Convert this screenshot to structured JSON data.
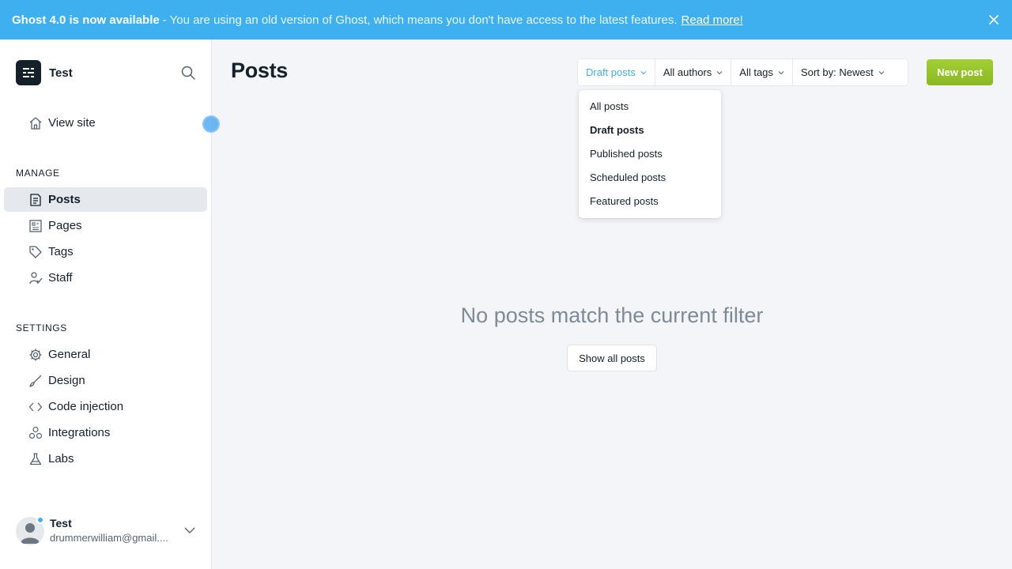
{
  "banner": {
    "strong": "Ghost 4.0 is now available",
    "message": "- You are using an old version of Ghost, which means you don't have access to the latest features.",
    "link": "Read more!",
    "close_icon": "close-icon"
  },
  "sidebar": {
    "site_name": "Test",
    "view_site": "View site",
    "manage_label": "MANAGE",
    "manage_items": [
      {
        "label": "Posts",
        "icon": "posts-icon",
        "active": true
      },
      {
        "label": "Pages",
        "icon": "pages-icon",
        "active": false
      },
      {
        "label": "Tags",
        "icon": "tag-icon",
        "active": false
      },
      {
        "label": "Staff",
        "icon": "staff-icon",
        "active": false
      }
    ],
    "settings_label": "SETTINGS",
    "settings_items": [
      {
        "label": "General",
        "icon": "gear-icon"
      },
      {
        "label": "Design",
        "icon": "brush-icon"
      },
      {
        "label": "Code injection",
        "icon": "code-icon"
      },
      {
        "label": "Integrations",
        "icon": "integrations-icon"
      },
      {
        "label": "Labs",
        "icon": "flask-icon"
      }
    ],
    "user": {
      "name": "Test",
      "email": "drummerwilliam@gmail...."
    }
  },
  "main": {
    "title": "Posts",
    "filters": {
      "type": "Draft posts",
      "authors": "All authors",
      "tags": "All tags",
      "sort": "Sort by: Newest"
    },
    "new_post": "New post",
    "type_options": [
      "All posts",
      "Draft posts",
      "Published posts",
      "Scheduled posts",
      "Featured posts"
    ],
    "selected_option": "Draft posts",
    "empty_message": "No posts match the current filter",
    "show_all": "Show all posts"
  },
  "colors": {
    "banner": "#3eb0ef",
    "accent_blue": "#3eb0ef",
    "primary_green": "#94c12a",
    "text": "#15212a"
  }
}
